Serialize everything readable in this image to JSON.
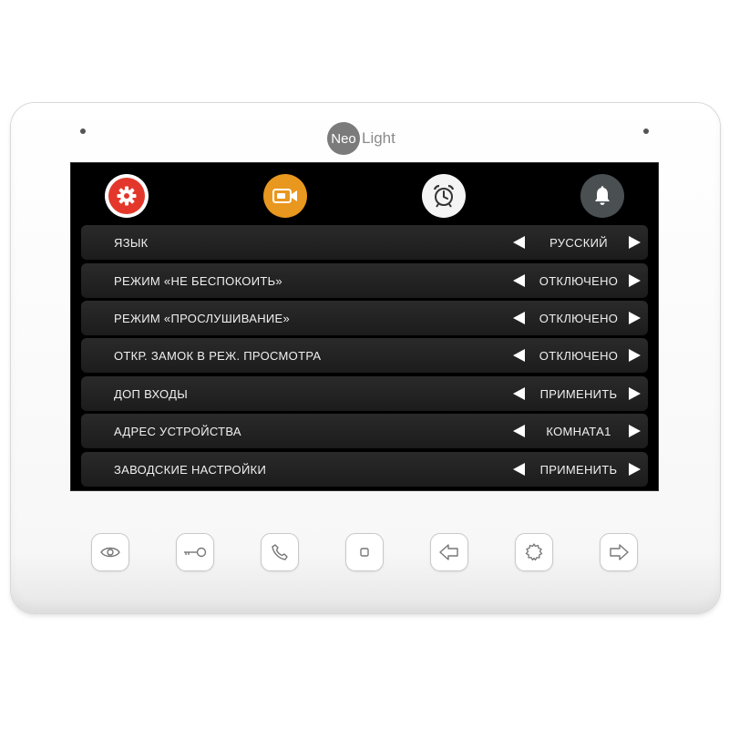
{
  "device": {
    "brand": {
      "logo_left": "Neo",
      "logo_right": "Light"
    }
  },
  "tabs": [
    {
      "name": "settings",
      "icon": "gear-icon",
      "color": "#e4372b",
      "active": true
    },
    {
      "name": "video",
      "icon": "camera-icon",
      "color": "#e8971f"
    },
    {
      "name": "alarm",
      "icon": "alarm-clock-icon",
      "color": "#f4f4f4"
    },
    {
      "name": "notifications",
      "icon": "bell-icon",
      "color": "#4a4f52"
    }
  ],
  "settings": [
    {
      "label": "ЯЗЫК",
      "value": "РУССКИЙ"
    },
    {
      "label": "РЕЖИМ «НЕ БЕСПОКОИТЬ»",
      "value": "ОТКЛЮЧЕНО"
    },
    {
      "label": "РЕЖИМ «ПРОСЛУШИВАНИЕ»",
      "value": "ОТКЛЮЧЕНО"
    },
    {
      "label": "ОТКР. ЗАМОК В РЕЖ. ПРОСМОТРА",
      "value": "ОТКЛЮЧЕНО"
    },
    {
      "label": "ДОП ВХОДЫ",
      "value": "ПРИМЕНИТЬ"
    },
    {
      "label": "АДРЕС УСТРОЙСТВА",
      "value": "КОМНАТА1"
    },
    {
      "label": "ЗАВОДСКИЕ НАСТРОЙКИ",
      "value": "ПРИМЕНИТЬ"
    }
  ],
  "hardware_buttons": [
    {
      "icon": "eye-icon"
    },
    {
      "icon": "key-icon"
    },
    {
      "icon": "phone-icon"
    },
    {
      "icon": "stop-icon"
    },
    {
      "icon": "arrow-left-icon"
    },
    {
      "icon": "gear-icon"
    },
    {
      "icon": "arrow-right-icon"
    }
  ]
}
